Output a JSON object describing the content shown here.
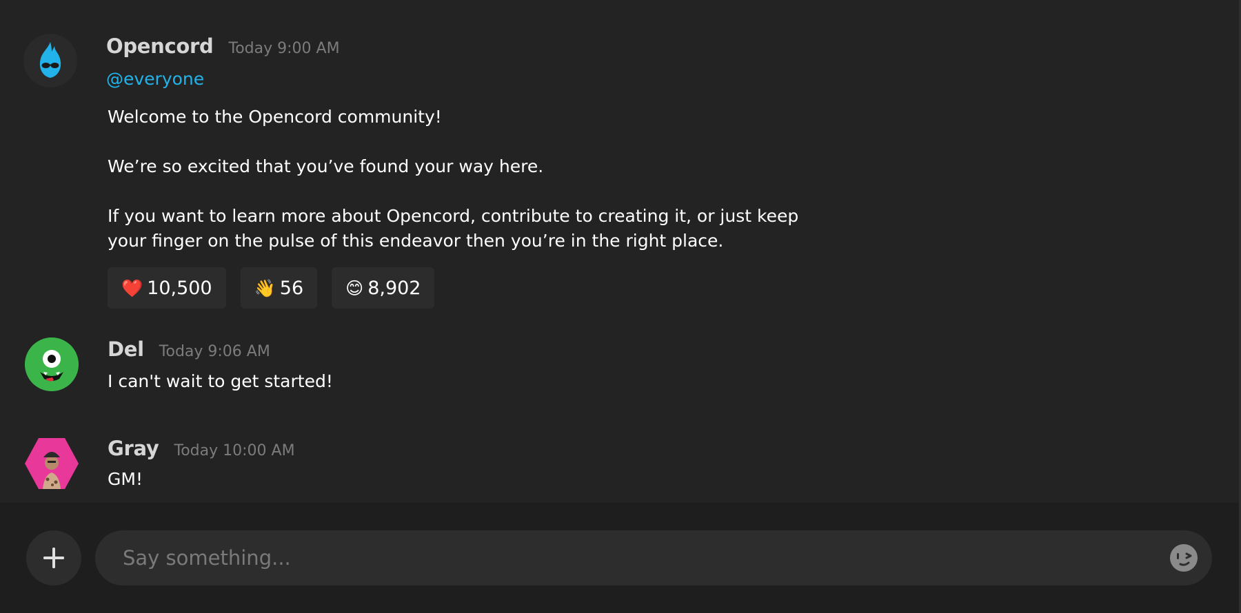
{
  "messages": [
    {
      "author": "Opencord",
      "timestamp": "Today 9:00 AM",
      "mention": "@everyone",
      "lines": [
        "Welcome to the Opencord community!",
        "We’re so excited that you’ve found your way here.",
        "If you want to learn more about Opencord, contribute to creating it, or just keep",
        "your finger on the pulse of this endeavor then you’re in the right place."
      ],
      "reactions": [
        {
          "emoji": "❤️",
          "icon": "heart-icon",
          "count": "10,500"
        },
        {
          "emoji": "👋",
          "icon": "wave-icon",
          "count": "56"
        },
        {
          "emoji": "😊",
          "icon": "smile-icon",
          "count": "8,902"
        }
      ]
    },
    {
      "author": "Del",
      "timestamp": "Today 9:06 AM",
      "text": "I can't wait to get started!"
    },
    {
      "author": "Gray",
      "timestamp": "Today 10:00 AM",
      "text": "GM!"
    }
  ],
  "composer": {
    "placeholder": "Say something...",
    "add_icon": "plus-icon",
    "emoji_icon": "emoji-wink-icon"
  },
  "colors": {
    "background": "#232323",
    "composer_background": "#1e1e1e",
    "mention": "#22b3ea",
    "avatar_del": "#3bb54a",
    "avatar_gray": "#e8389a",
    "avatar_opencord_flame": "#22b3ea"
  }
}
